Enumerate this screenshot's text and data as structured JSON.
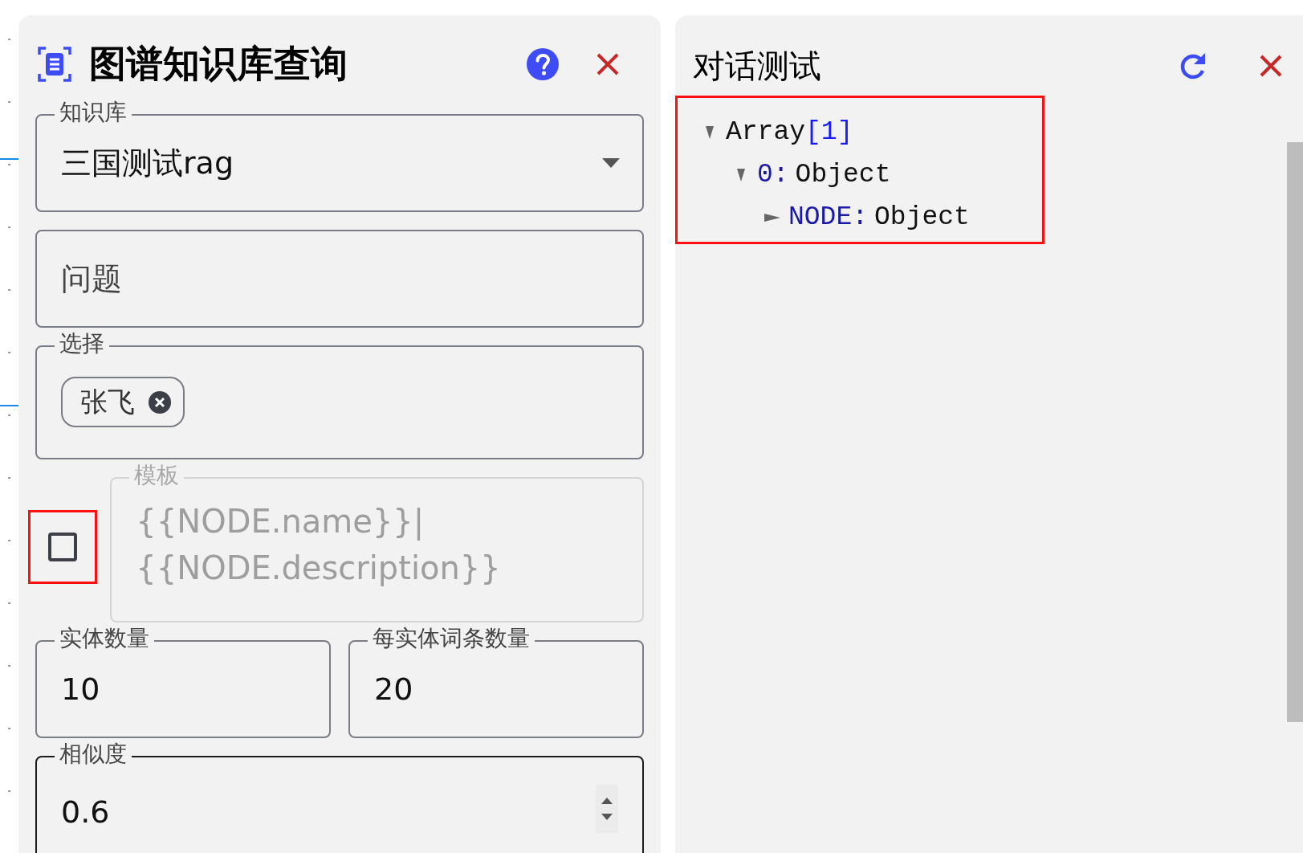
{
  "left_panel": {
    "title": "图谱知识库查询",
    "fields": [
      {
        "kind": "select",
        "label": "知识库",
        "value": "三国测试rag"
      },
      {
        "kind": "text",
        "placeholder": "问题"
      },
      {
        "kind": "chips",
        "label": "选择",
        "chips": [
          "张飞"
        ]
      }
    ],
    "template": {
      "checked": false,
      "highlighted": true,
      "disabled": true,
      "label": "模板",
      "value_lines": [
        "{{NODE.name}}|",
        "{{NODE.description}}"
      ]
    },
    "counts": [
      {
        "label": "实体数量",
        "value": "10"
      },
      {
        "label": "每实体词条数量",
        "value": "20"
      }
    ],
    "similarity": {
      "label": "相似度",
      "value": "0.6",
      "focused": true
    }
  },
  "right_panel": {
    "title": "对话测试",
    "output": {
      "highlighted": true,
      "tree": [
        {
          "kind": "array",
          "type": "Array",
          "name": "[1]",
          "expanded": true,
          "children": [
            {
              "kind": "property",
              "name": "0:",
              "type": "Object",
              "expanded": true,
              "children": [
                {
                  "kind": "property",
                  "name": "NODE:",
                  "type": "Object",
                  "expanded": false
                }
              ]
            }
          ]
        }
      ]
    }
  }
}
